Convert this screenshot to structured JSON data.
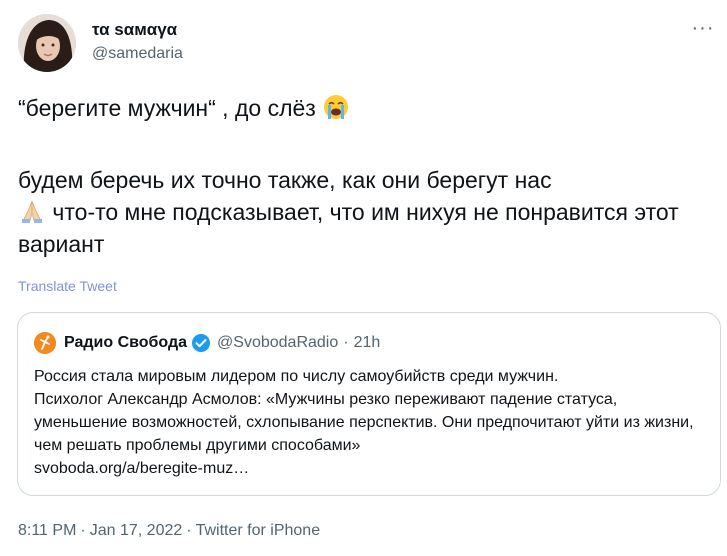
{
  "author": {
    "display_name": "τα ѕαмαγα",
    "handle": "@samedaria"
  },
  "more_menu": "···",
  "tweet": {
    "line1": "“берегите мужчин“ , до слёз",
    "line1_emoji": "loudly-crying-face",
    "para2_a": "будем беречь их точно также, как они берегут нас",
    "para2_emoji": "folded-hands",
    "para2_b": " что-то мне подсказывает, что им нихуя не понравится этот вариант"
  },
  "translate_link": "Translate Tweet",
  "quoted": {
    "name": "Радио Свобода",
    "handle": "@SvobodaRadio",
    "separator": "·",
    "time": "21h",
    "text_1": "Россия стала мировым лидером по числу самоубийств среди мужчин.",
    "text_2": "Психолог Александр Асмолов: «Мужчины резко переживают падение статуса, уменьшение возможностей, схлопывание перспектив. Они предпочитают уйти из жизни, чем решать проблемы другими способами»",
    "link": "svoboda.org/a/beregite-muz…",
    "logo_color": "#f28a1e",
    "verified_color": "#1d9bf0"
  },
  "meta": {
    "time": "8:11 PM",
    "date": "Jan 17, 2022",
    "source": "Twitter for iPhone",
    "separator": "·"
  }
}
